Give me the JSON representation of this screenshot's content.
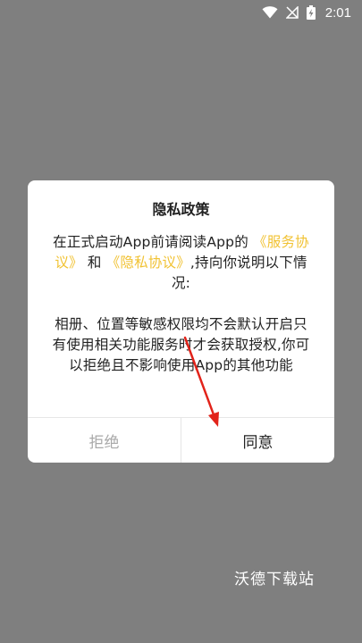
{
  "status_bar": {
    "time": "2:01",
    "icons": [
      "wifi-icon",
      "signal-off-icon",
      "battery-charging-icon"
    ]
  },
  "dialog": {
    "title": "隐私政策",
    "intro_before": "在正式启动App前请阅读App的",
    "link_service": "《服务协议》",
    "intro_and": "和",
    "link_privacy": "《隐私协议》",
    "intro_after": ",持向你说明以下情况:",
    "paragraph2": "相册、位置等敏感权限均不会默认开启只有使用相关功能服务时才会获取授权,你可以拒绝且不影响使用App的其他功能",
    "reject_label": "拒绝",
    "agree_label": "同意"
  },
  "watermark": {
    "text": "沃德下载站"
  },
  "colors": {
    "background": "#7f7f7f",
    "link": "#f1c232",
    "arrow": "#e2231a"
  }
}
